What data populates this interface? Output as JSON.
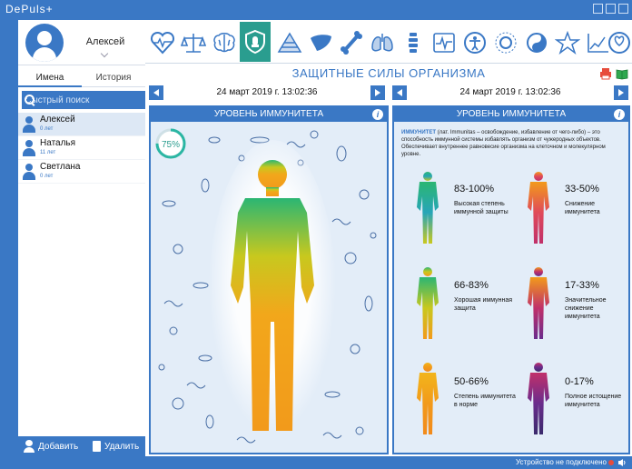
{
  "app": {
    "title": "DePuls+"
  },
  "profile": {
    "name": "Алексей"
  },
  "left_tabs": [
    {
      "label": "Имена"
    },
    {
      "label": "История"
    }
  ],
  "search": {
    "placeholder": "Быстрый поиск"
  },
  "people": [
    {
      "name": "Алексей",
      "age": "0 лет"
    },
    {
      "name": "Наталья",
      "age": "11 лет"
    },
    {
      "name": "Светлана",
      "age": "0 лет"
    }
  ],
  "left_buttons": {
    "add": "Добавить",
    "delete": "Удалить"
  },
  "icons": [
    "heart-icon",
    "scales-icon",
    "brain-icon",
    "shield-icon",
    "pyramid-icon",
    "liver-icon",
    "bone-icon",
    "lungs-icon",
    "spine-icon",
    "ecg-icon",
    "accessibility-icon",
    "sun-icon",
    "yin-yang-icon",
    "star-icon",
    "graph-icon",
    "ribbon-icon"
  ],
  "section": {
    "title": "ЗАЩИТНЫЕ СИЛЫ ОРГАНИЗМА"
  },
  "dates": {
    "left": "24 март 2019 г. 13:02:36",
    "right": "24 март 2019 г. 13:02:36"
  },
  "left_panel": {
    "title": "УРОВЕНЬ ИММУНИТЕТА",
    "gauge_value": "75%",
    "gauge_fraction": 0.75
  },
  "right_panel": {
    "title": "УРОВЕНЬ ИММУНИТЕТА",
    "term": "ИММУНИТЕТ",
    "description": " (лат. Immunitas – освобождение, избавление от чего-либо) – это способность иммунной системы избавлять организм от чужеродных объектов. Обеспечивает внутреннее равновесие организма на клеточном и молекулярном уровне.",
    "levels": [
      {
        "range": "83-100%",
        "label": "Высокая степень иммунной защиты"
      },
      {
        "range": "33-50%",
        "label": "Снижение иммунитета"
      },
      {
        "range": "66-83%",
        "label": "Хорошая иммунная защита"
      },
      {
        "range": "17-33%",
        "label": "Значительное снижение иммунитета"
      },
      {
        "range": "50-66%",
        "label": "Степень иммунитета в норме"
      },
      {
        "range": "0-17%",
        "label": "Полное истощение иммунитета"
      }
    ]
  },
  "status": {
    "text": "Устройство не подключено"
  }
}
